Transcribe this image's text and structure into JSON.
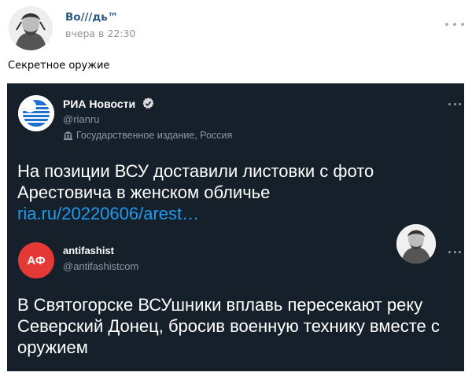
{
  "post": {
    "author": "Во///дь™",
    "time": "вчера в 22:30",
    "text": "Секретное оружие"
  },
  "tweet1": {
    "name": "РИА Новости",
    "handle": "@rianru",
    "label": "Государственное издание, Россия",
    "text": "На позиции ВСУ доставили листовки с фото Арестовича в женском обличье",
    "link": "ria.ru/20220606/arest…"
  },
  "tweet2": {
    "name": "antifashist",
    "handle": "@antifashistcom",
    "avatar_text": "АФ",
    "text": "В Святогорске ВСУшники вплавь пересекают реку Северский Донец, бросив военную технику вместе с оружием"
  },
  "colors": {
    "author_link": "#2a5885",
    "tweet_bg": "#15202b",
    "link_blue": "#1d9bf0",
    "af_red": "#e53935",
    "ria_blue": "#1e6fd0"
  },
  "icons": {
    "more": "more-horizontal-icon",
    "verified": "verified-badge-icon",
    "label": "government-building-icon"
  }
}
